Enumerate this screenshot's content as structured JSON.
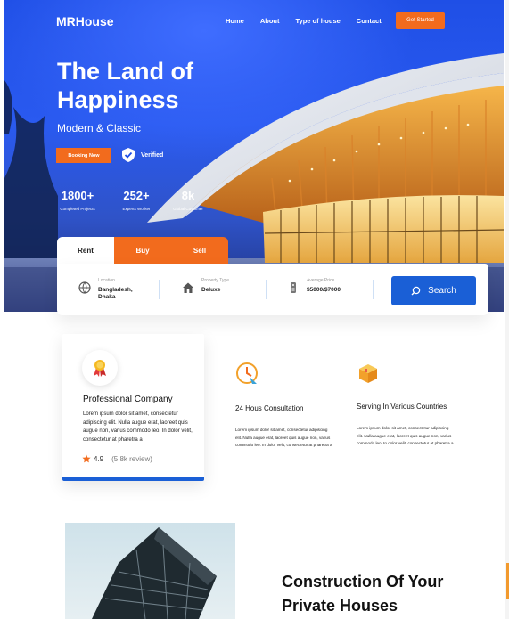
{
  "nav": {
    "logo": "MRHouse",
    "links": [
      "Home",
      "About",
      "Type of house",
      "Contact"
    ],
    "cta": "Get Started"
  },
  "hero": {
    "title": "The Land of Happiness",
    "subtitle": "Modern & Classic",
    "booking_label": "Booking Now",
    "verified_label": "Verified",
    "stats": [
      {
        "value": "1800+",
        "label": "Completed Projects"
      },
      {
        "value": "252+",
        "label": "Experts Worker"
      },
      {
        "value": "8k",
        "label": "Global Customer"
      }
    ]
  },
  "search": {
    "tabs": [
      "Rent",
      "Buy",
      "Sell"
    ],
    "active_tab": "Rent",
    "fields": [
      {
        "label": "Location",
        "value": "Bangladesh, Dhaka",
        "icon": "globe-icon"
      },
      {
        "label": "Property Type",
        "value": "Deluxe",
        "icon": "house-icon"
      },
      {
        "label": "Average Price",
        "value": "$5000/$7000",
        "icon": "price-tag-icon"
      }
    ],
    "button_label": "Search"
  },
  "features": {
    "card": {
      "title": "Professional Company",
      "text": "Lorem ipsum dolor sit amet, consectetur adipiscing elit. Nulla augue erat, laoreet quis augue non, varius commodo leo. In dolor velit, consectetur at pharetra a",
      "rating": "4.9",
      "reviews": "(5.8k review)"
    },
    "items": [
      {
        "title": "24 Hous Consultation",
        "text": "Lorem ipsum dolor sit amet, consectetur adipiscing elit. Nulla augue erat, laoreet quis augue non, varius commodo leo. In dolor velit, consectetur at pharetra a",
        "icon": "clock-icon"
      },
      {
        "title": "Serving In Various Countries",
        "text": "Lorem ipsum dolor sit amet, consectetur adipiscing elit. Nulla augue erat, laoreet quis augue non, varius commodo leo. In dolor velit, consectetur at pharetra a",
        "icon": "box-icon"
      }
    ]
  },
  "construction": {
    "title": "Construction Of Your Private Houses"
  },
  "colors": {
    "brand_blue": "#1a5fd6",
    "accent_orange": "#f26b1d"
  }
}
